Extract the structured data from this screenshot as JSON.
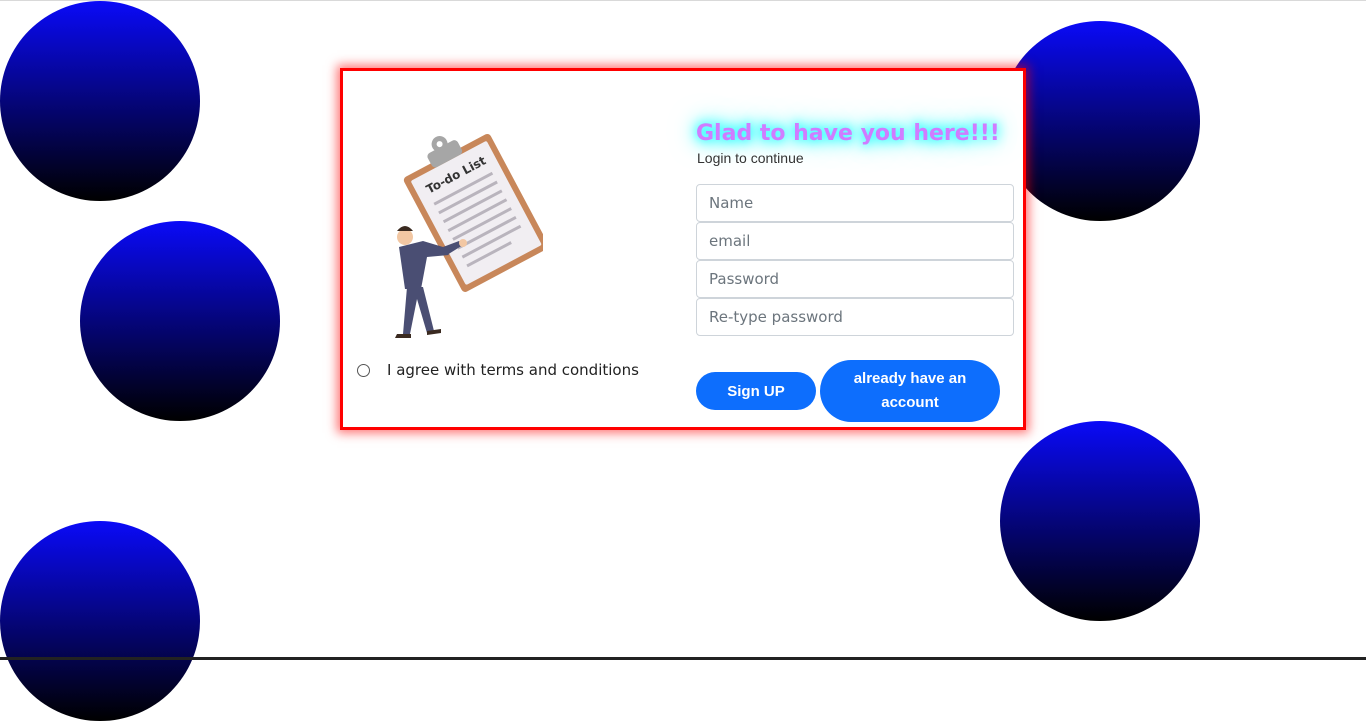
{
  "form": {
    "heading": "Glad to have you here!!!",
    "subheading": "Login to continue",
    "name_placeholder": "Name",
    "email_placeholder": "email",
    "password_placeholder": "Password",
    "retype_placeholder": "Re-type password",
    "signup_label": "Sign UP",
    "login_label": "already have an account"
  },
  "terms": {
    "label": "I agree with terms and conditions",
    "checked": false
  },
  "illustration": {
    "clipboard_text": "To-do List"
  },
  "colors": {
    "card_border": "#ff0000",
    "button": "#0d6efd",
    "heading_text": "#d07cff",
    "heading_glow": "#00ffff",
    "bubble_top": "#0a0af8",
    "bubble_bottom": "#000000"
  }
}
